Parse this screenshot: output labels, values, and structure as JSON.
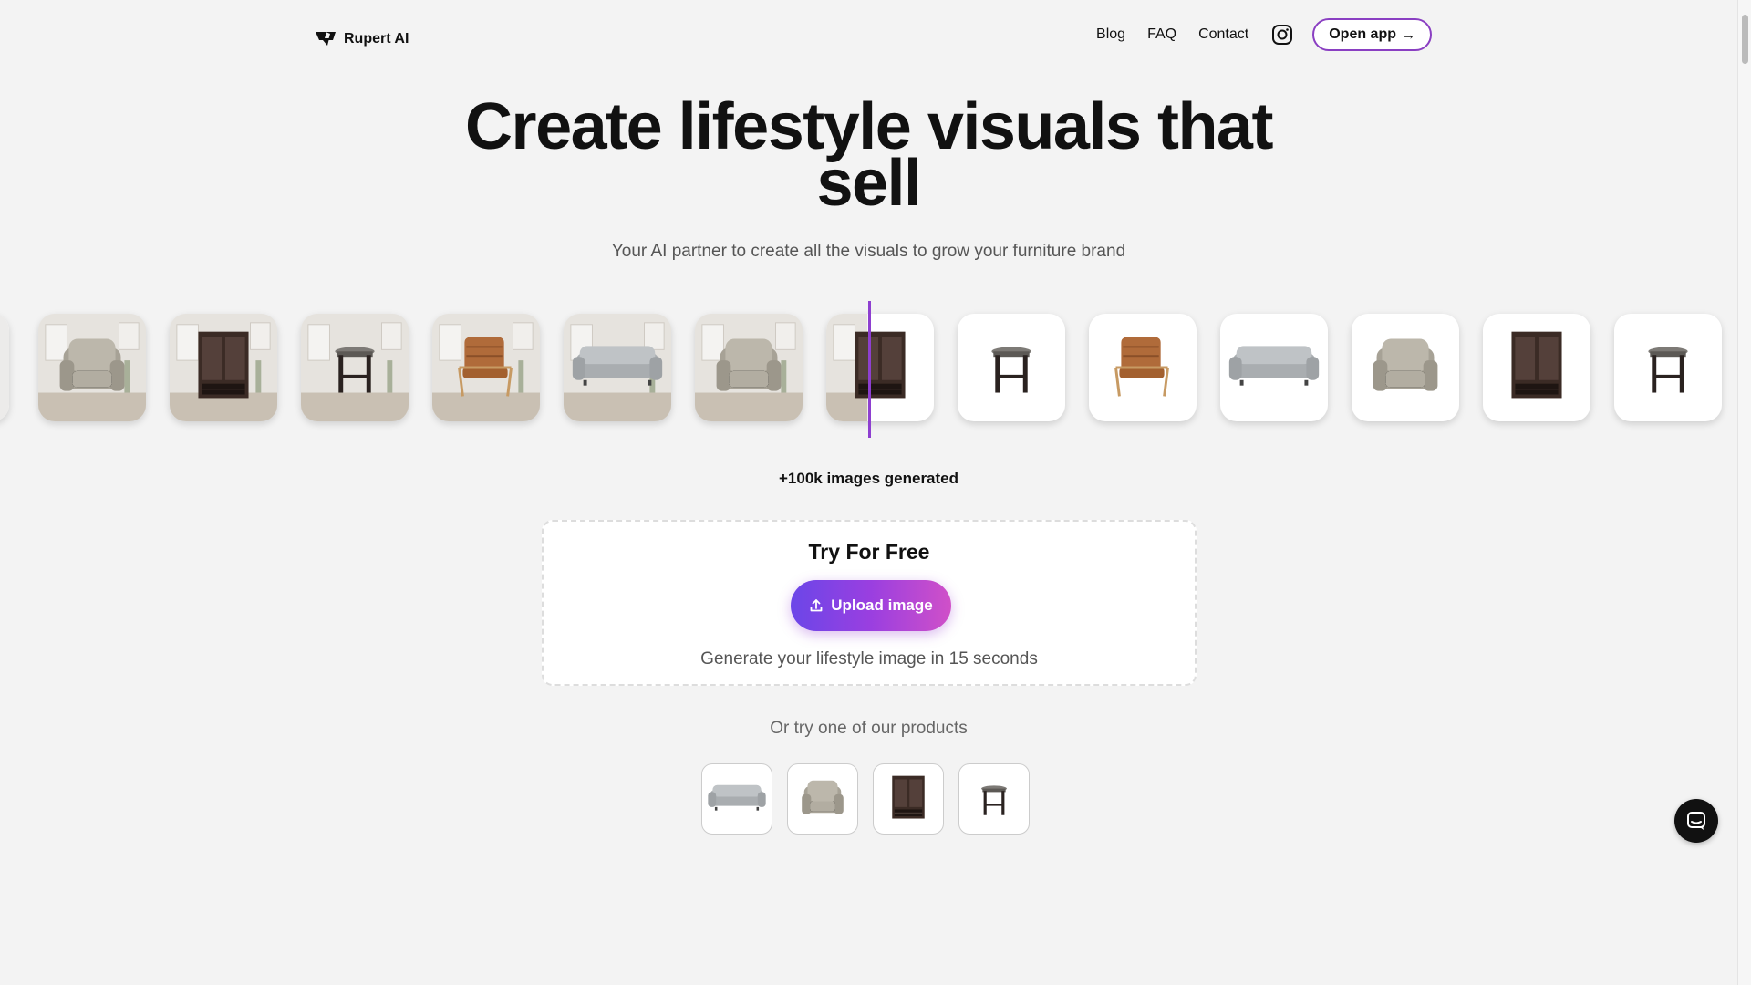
{
  "header": {
    "brand": "Rupert AI",
    "nav": [
      {
        "label": "Blog"
      },
      {
        "label": "FAQ"
      },
      {
        "label": "Contact"
      }
    ],
    "instagram_icon": "instagram-icon",
    "open_app_label": "Open app",
    "open_app_arrow": "→"
  },
  "hero": {
    "title": "Create lifestyle visuals that sell",
    "subtitle": "Your AI partner to create all the visuals to grow your furniture brand"
  },
  "carousel": {
    "items": [
      {
        "kind": "scene",
        "product": "recliner"
      },
      {
        "kind": "scene",
        "product": "cabinet"
      },
      {
        "kind": "scene",
        "product": "side-table"
      },
      {
        "kind": "scene",
        "product": "leather-chair"
      },
      {
        "kind": "scene",
        "product": "sofa"
      },
      {
        "kind": "scene",
        "product": "recliner"
      },
      {
        "kind": "split",
        "product": "cabinet"
      },
      {
        "kind": "plain",
        "product": "side-table"
      },
      {
        "kind": "plain",
        "product": "leather-chair"
      },
      {
        "kind": "plain",
        "product": "sofa"
      },
      {
        "kind": "plain",
        "product": "recliner"
      },
      {
        "kind": "plain",
        "product": "cabinet"
      },
      {
        "kind": "plain",
        "product": "side-table"
      }
    ]
  },
  "stats": {
    "generated": "+100k images generated"
  },
  "try": {
    "title": "Try For Free",
    "upload_label": "Upload image",
    "upload_icon": "upload-icon",
    "caption": "Generate your lifestyle image in 15 seconds"
  },
  "products": {
    "heading": "Or try one of our products",
    "items": [
      {
        "name": "sofa"
      },
      {
        "name": "recliner"
      },
      {
        "name": "cabinet"
      },
      {
        "name": "side-table"
      }
    ]
  },
  "chat": {
    "icon": "chat-icon"
  },
  "colors": {
    "accent": "#9a3fe0",
    "background": "#f3f3f3",
    "divider": "#8e3fd0"
  }
}
